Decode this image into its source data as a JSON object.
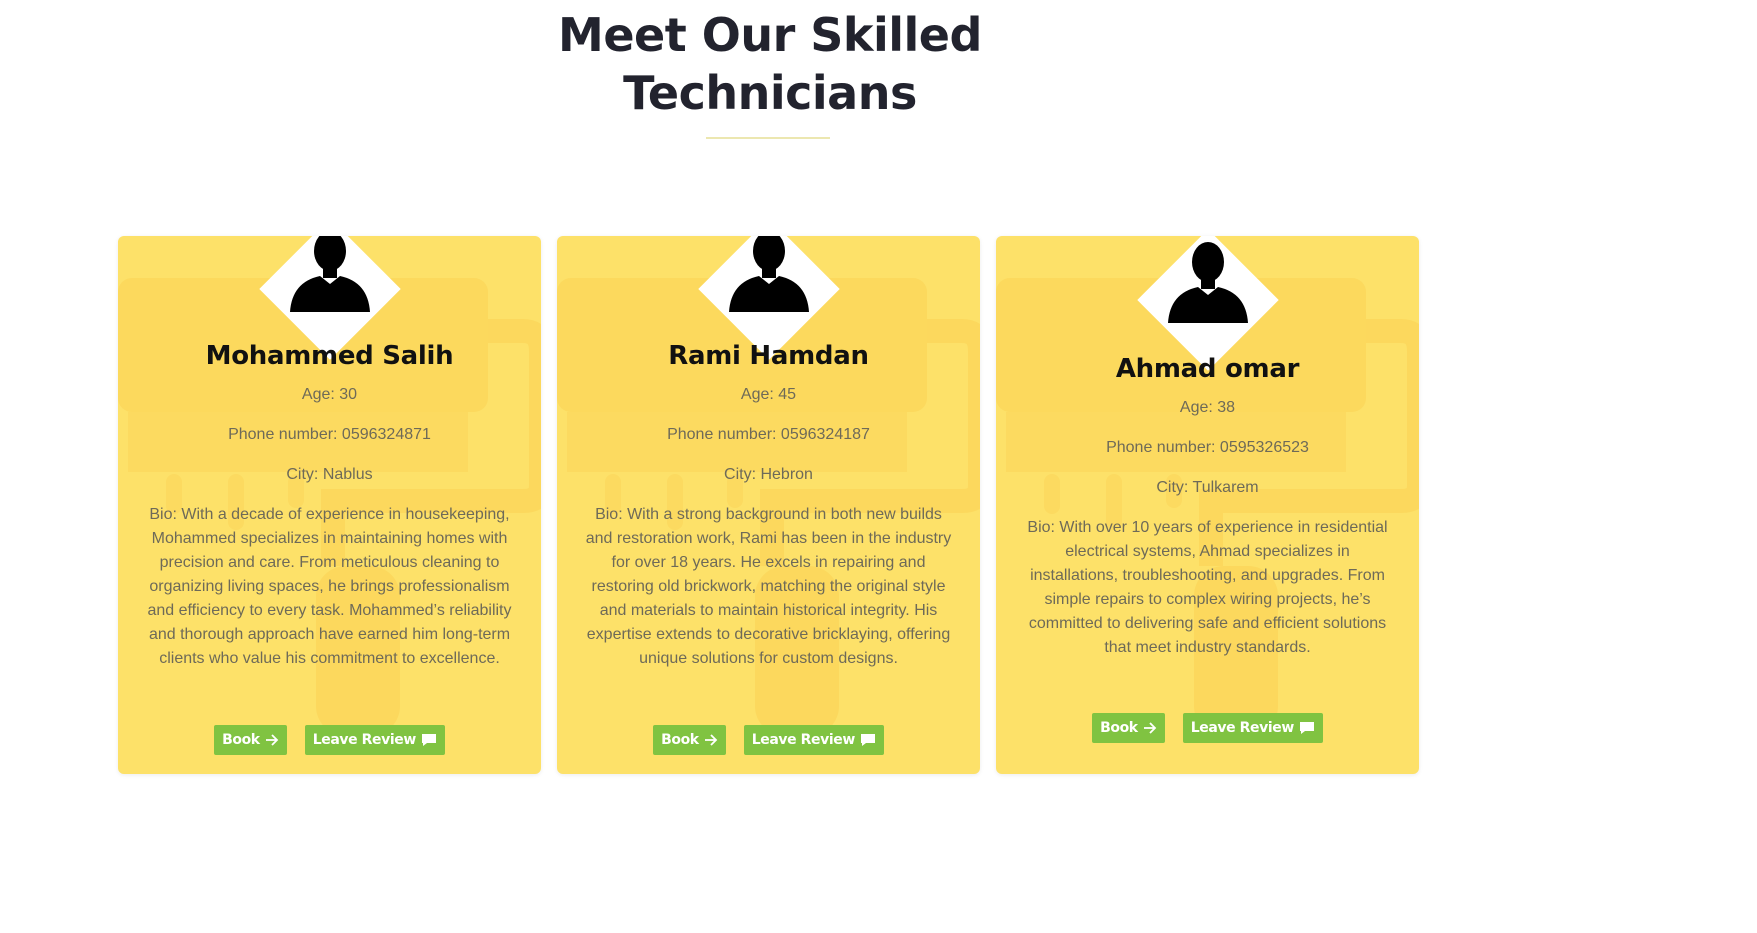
{
  "section": {
    "title_line1": "Meet Our Skilled",
    "title_line2": "Technicians"
  },
  "colors": {
    "card_bg": "#fde169",
    "button_bg": "#80c341",
    "title": "#22232e"
  },
  "technicians": [
    {
      "name": "Mohammed Salih",
      "age": "Age: 30",
      "phone": "Phone number: 0596324871",
      "city": "City: Nablus",
      "bio": "Bio: With a decade of experience in housekeeping, Mohammed specializes in maintaining homes with precision and care. From meticulous cleaning to organizing living spaces, he brings professionalism and efficiency to every task. Mohammed’s reliability and thorough approach have earned him long-term clients who value his commitment to excellence.",
      "book_label": "Book",
      "review_label": "Leave Review"
    },
    {
      "name": "Rami Hamdan",
      "age": "Age: 45",
      "phone": "Phone number: 0596324187",
      "city": "City: Hebron",
      "bio": "Bio: With a strong background in both new builds and restoration work, Rami has been in the industry for over 18 years. He excels in repairing and restoring old brickwork, matching the original style and materials to maintain historical integrity. His expertise extends to decorative bricklaying, offering unique solutions for custom designs.",
      "book_label": "Book",
      "review_label": "Leave Review"
    },
    {
      "name": "Ahmad omar",
      "age": "Age: 38",
      "phone": "Phone number: 0595326523",
      "city": "City: Tulkarem",
      "bio": "Bio: With over 10 years of experience in residential electrical systems, Ahmad specializes in installations, troubleshooting, and upgrades. From simple repairs to complex wiring projects, he’s committed to delivering safe and efficient solutions that meet industry standards.",
      "book_label": "Book",
      "review_label": "Leave Review"
    }
  ],
  "icons": {
    "avatar": "person-silhouette-icon",
    "book": "arrow-right-icon",
    "review": "comment-icon",
    "background": "paint-roller-icon"
  }
}
